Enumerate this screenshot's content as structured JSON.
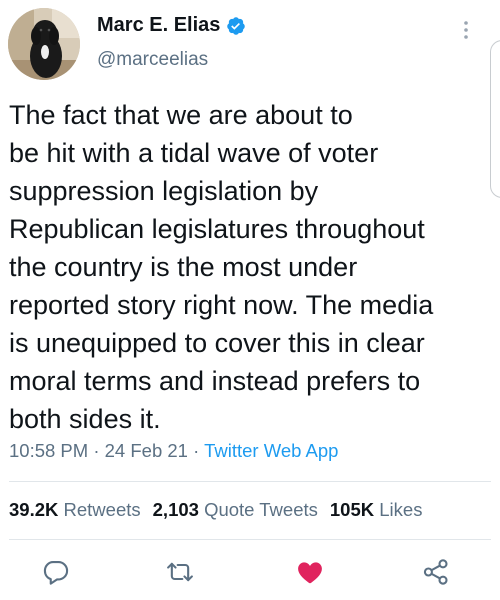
{
  "author": {
    "display_name": "Marc E. Elias",
    "handle": "@marceelias",
    "verified": true
  },
  "tweet": {
    "text": "The fact that we are about to\nbe hit with a tidal wave of voter\nsuppression legislation by\nRepublican legislatures throughout\nthe country is the most under\nreported story right now. The media\nis unequipped to cover this in clear\nmoral terms and instead prefers to\nboth sides it."
  },
  "meta": {
    "time": "10:58 PM",
    "separator": " · ",
    "date": "24 Feb 21",
    "source": "Twitter Web App"
  },
  "stats": {
    "retweets_count": "39.2K",
    "retweets_label": "Retweets",
    "quote_count": "2,103",
    "quote_label": "Quote Tweets",
    "likes_count": "105K",
    "likes_label": "Likes"
  },
  "icons": {
    "reply": "reply-icon",
    "retweet": "retweet-icon",
    "like": "heart-icon",
    "share": "share-icon",
    "more": "more-vertical-icon"
  },
  "colors": {
    "link": "#1d9bf0",
    "secondary_text": "#5b7083",
    "like_active": "#e0245e",
    "icon": "#5b7083",
    "verified": "#1d9bf0"
  },
  "liked": true
}
